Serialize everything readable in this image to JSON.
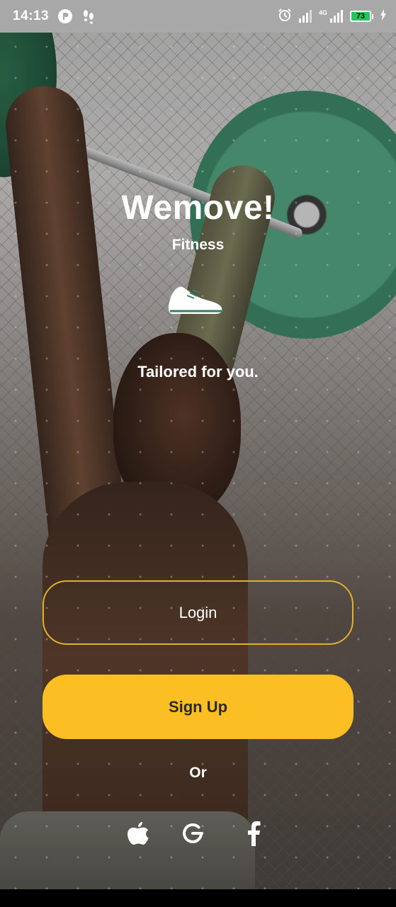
{
  "status_bar": {
    "time": "14:13",
    "network_label": "4G",
    "battery_level": "73",
    "icons": [
      "app-notification-icon",
      "footsteps-icon",
      "alarm-icon",
      "wifi-signal-icon",
      "cell-signal-icon",
      "battery-icon",
      "charging-icon"
    ]
  },
  "brand": {
    "title": "Wemove!",
    "subtitle": "Fitness",
    "logo_icon": "sneaker-icon"
  },
  "tagline": "Tailored for you.",
  "actions": {
    "login_label": "Login",
    "signup_label": "Sign Up",
    "or_label": "Or"
  },
  "social_login": [
    {
      "name": "apple",
      "icon": "apple-icon"
    },
    {
      "name": "google",
      "icon": "google-icon"
    },
    {
      "name": "facebook",
      "icon": "facebook-icon"
    }
  ],
  "colors": {
    "accent": "#fbbf24",
    "login_border": "#e2b12a",
    "text": "#ffffff",
    "status_bar_bg": "#a8a8a8",
    "battery_fill": "#22c55e"
  }
}
